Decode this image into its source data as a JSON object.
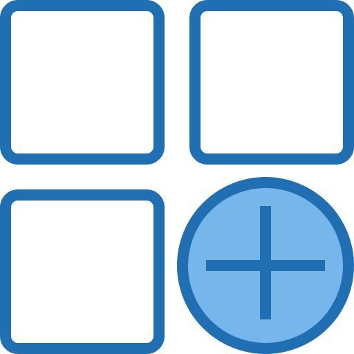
{
  "icon": {
    "name": "add-app-icon",
    "colors": {
      "stroke": "#1f6fb2",
      "fill_inner": "#ffffff",
      "fill_circle": "#77b6ea"
    },
    "tiles": [
      {
        "name": "app-tile-top-left"
      },
      {
        "name": "app-tile-top-right"
      },
      {
        "name": "app-tile-bottom-left"
      }
    ],
    "add_button": {
      "name": "add-circle-plus-icon"
    }
  }
}
